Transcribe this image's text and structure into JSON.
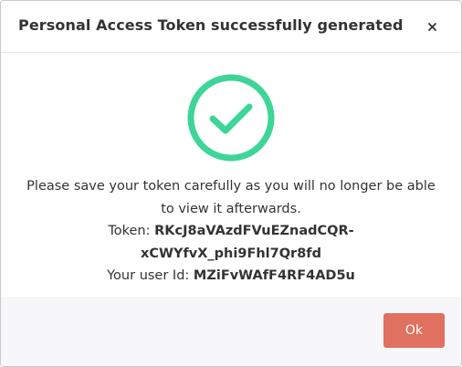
{
  "dialog": {
    "title": "Personal Access Token successfully generated",
    "close_icon": "close-icon",
    "status_icon": "check-circle-icon",
    "message_line1": "Please save your token carefully as you will no longer be able",
    "message_line2": "to view it afterwards.",
    "token_label": "Token:",
    "token_part1": "RKcJ8aVAzdFVuEZnadCQR-",
    "token_part2": "xCWYfvX_phi9Fhl7Qr8fd",
    "user_id_label": "Your user Id:",
    "user_id": "MZiFvWAfF4RF4AD5u",
    "ok_label": "Ok"
  },
  "colors": {
    "success_green": "#3dd598",
    "ok_button": "#e0705f",
    "footer_bg": "#f7f7f9",
    "text": "#333333"
  }
}
